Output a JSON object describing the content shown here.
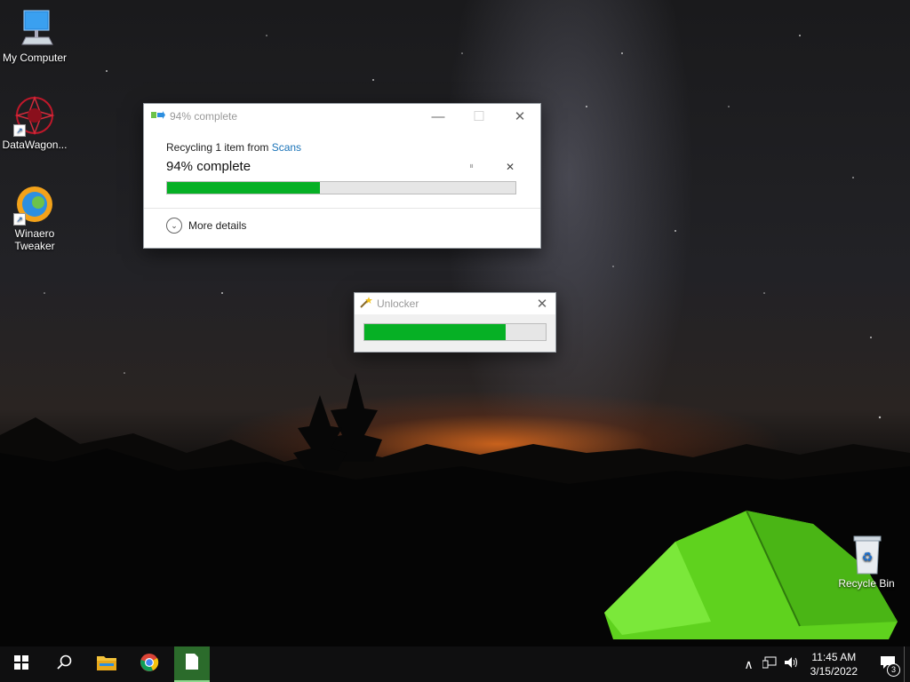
{
  "desktop": {
    "icons": [
      {
        "label": "My Computer"
      },
      {
        "label": "DataWagon..."
      },
      {
        "label": "Winaero Tweaker"
      },
      {
        "label": "Recycle Bin"
      }
    ]
  },
  "copy_dialog": {
    "title": "94% complete",
    "line_prefix": "Recycling 1 item from ",
    "line_link": "Scans",
    "status": "94% complete",
    "progress_fraction": 0.44,
    "more_details": "More details",
    "pause_glyph": "⏸",
    "close_glyph": "✕"
  },
  "unlocker_dialog": {
    "title": "Unlocker",
    "progress_fraction": 0.78
  },
  "taskbar": {
    "time": "11:45 AM",
    "date": "3/15/2022",
    "notifications_count": "3",
    "active_app": "notepad"
  },
  "colors": {
    "progress_green": "#06b025",
    "link_blue": "#1a73b8",
    "taskbar_bg": "#0f0f10"
  }
}
